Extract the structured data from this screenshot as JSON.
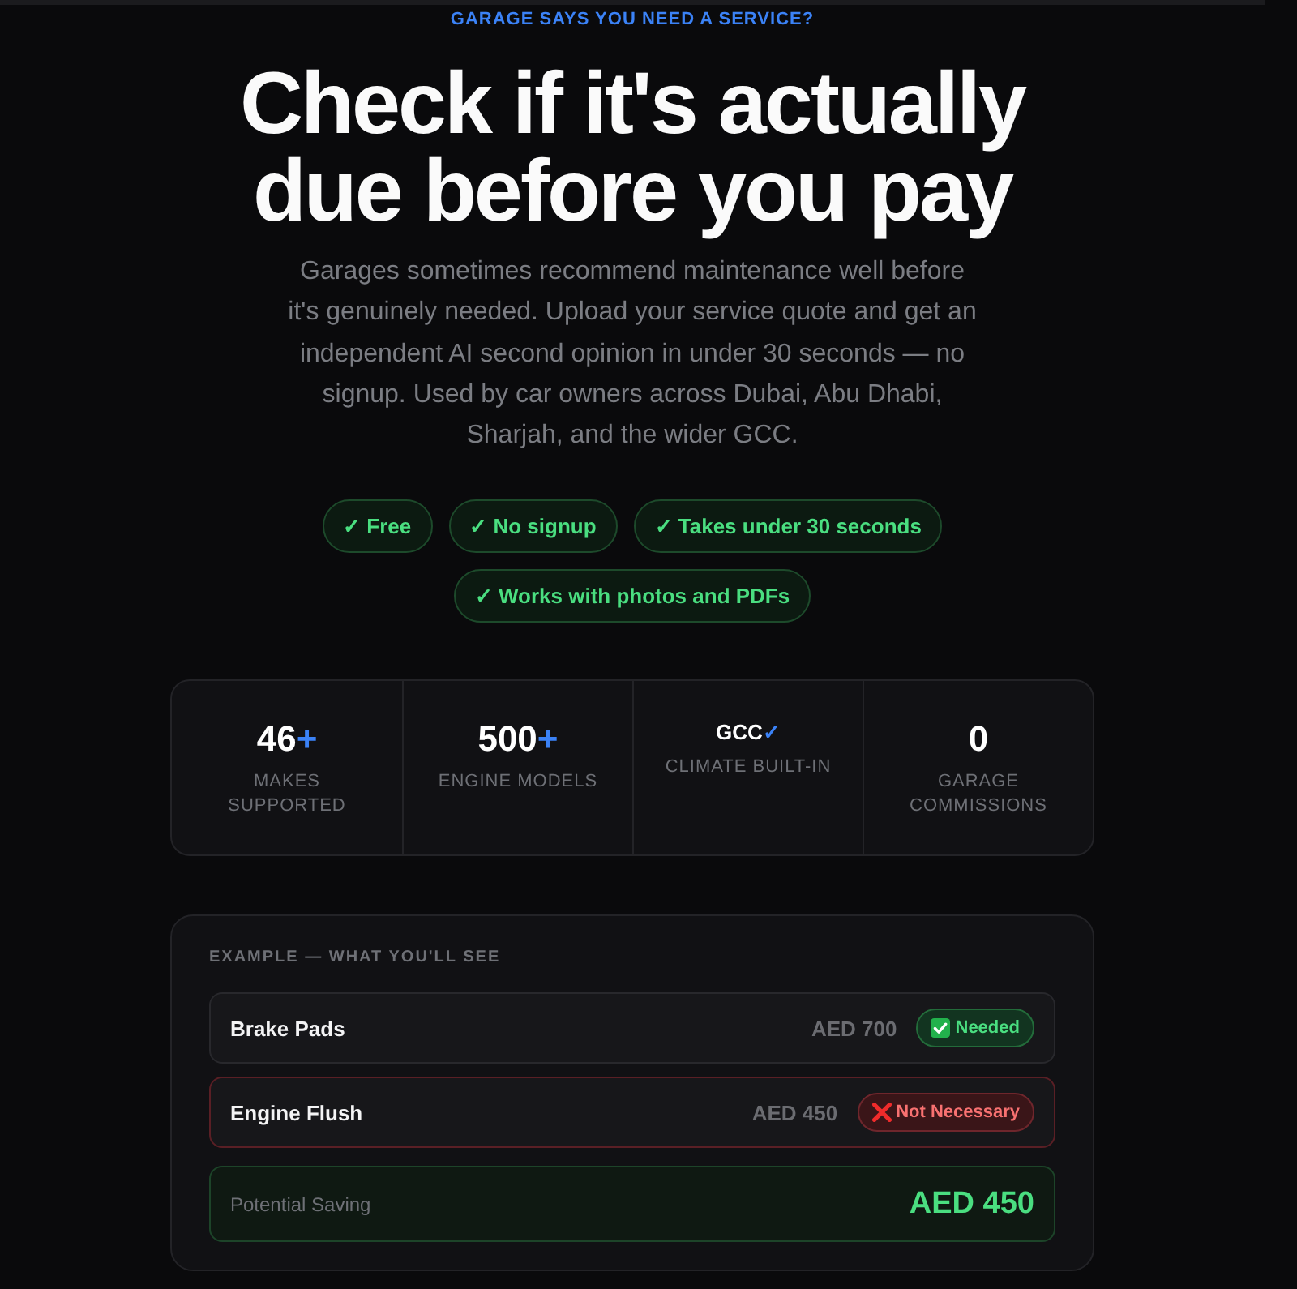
{
  "eyebrow": "GARAGE SAYS YOU NEED A SERVICE?",
  "heading": "Check if it's actually due before you pay",
  "intro": "Garages sometimes recommend maintenance well before it's genuinely needed. Upload your service quote and get an independent AI second opinion in under 30 seconds — no signup. Used by car owners across Dubai, Abu Dhabi, Sharjah, and the wider GCC.",
  "features": [
    "✓ Free",
    "✓ No signup",
    "✓ Takes under 30 seconds",
    "✓ Works with photos and PDFs"
  ],
  "stats": [
    {
      "kind": "count",
      "value": "46",
      "suffix": "+",
      "label": "MAKES SUPPORTED"
    },
    {
      "kind": "count",
      "value": "500",
      "suffix": "+",
      "label": "ENGINE MODELS"
    },
    {
      "kind": "tag",
      "value": "GCC",
      "suffix": "✓",
      "label": "CLIMATE BUILT-IN"
    },
    {
      "kind": "count",
      "value": "0",
      "label": "GARAGE COMMISSIONS"
    }
  ],
  "example": {
    "title": "EXAMPLE — WHAT YOU'LL SEE",
    "items": [
      {
        "name": "Brake Pads",
        "price": "AED 700",
        "verdict": {
          "kind": "needed",
          "label": "Needed"
        }
      },
      {
        "name": "Engine Flush",
        "price": "AED 450",
        "verdict": {
          "kind": "not_needed",
          "label": "Not Necessary"
        }
      }
    ],
    "saving": {
      "label": "Potential Saving",
      "amount": "AED 450"
    }
  }
}
